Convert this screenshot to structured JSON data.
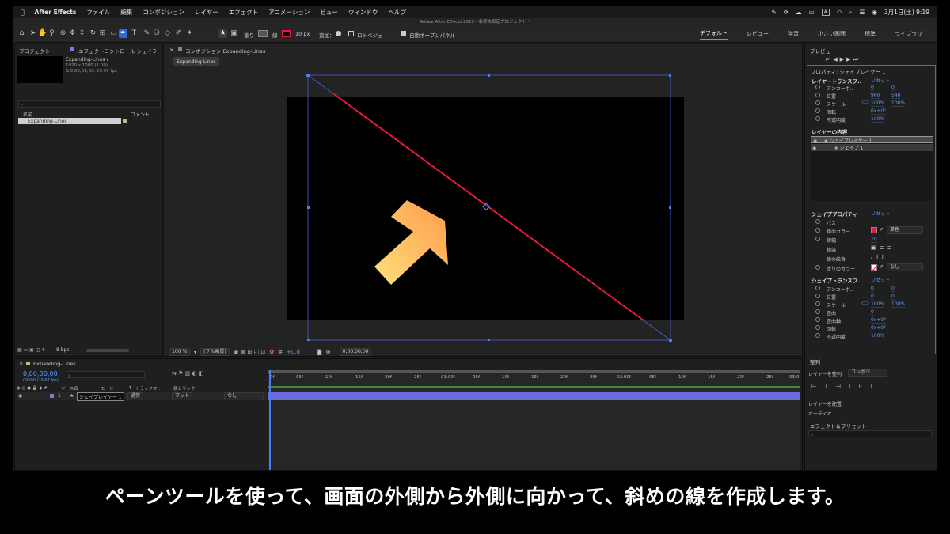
{
  "menubar": {
    "app": "After Effects",
    "items": [
      "ファイル",
      "編集",
      "コンポジション",
      "レイヤー",
      "エフェクト",
      "アニメーション",
      "ビュー",
      "ウィンドウ",
      "ヘルプ"
    ],
    "clock": "3月1日(土) 9:19",
    "input_mode": "A"
  },
  "window": {
    "title": "Adobe After Effects 2025 - 名称未設定プロジェクト *"
  },
  "toolbar": {
    "fill_label": "塗り",
    "stroke_label": "線",
    "stroke_width": "10 px",
    "add_label": "追加：",
    "rotobezier_label": "ロトベジェ",
    "auto_open_label": "自動オープンパネル",
    "workspaces": [
      "デフォルト",
      "レビュー",
      "学習",
      "小さい画面",
      "標準",
      "ライブラリ"
    ]
  },
  "project": {
    "tab_project": "プロジェクト",
    "tab_effect": "エフェクトコントロール シェイプ",
    "comp_name": "Expanding-Lines ▾",
    "comp_size": "1920 x 1080 (1.00)",
    "comp_duration": "Δ 0;00;03;00, 29.97 fps",
    "search_placeholder": "",
    "col_name": "名前",
    "col_comment": "コメント",
    "item_name": "Expanding-Lines",
    "bpc": "8 bpc"
  },
  "comp_panel": {
    "tab_label": "コンポジション Expanding-Lines",
    "flow_tab": "Expanding-Lines",
    "zoom": "100 %",
    "quality": "(フル画質)",
    "exposure": "+0.0",
    "timecode": "0;00;00;00"
  },
  "timeline": {
    "tab_label": "Expanding-Lines",
    "timecode": "0;00;00;00",
    "fps_sub": "00000 (29.97 fps)",
    "col_source": "ソース名",
    "col_mode": "モード",
    "col_t": "T",
    "col_track": "トラックマ..",
    "col_parent": "親とリンク",
    "layer_num": "1",
    "layer_name": "シェイプレイヤー 1",
    "layer_mode": "通常",
    "layer_matte": "マット",
    "layer_parent": "なし",
    "ruler": [
      "0f",
      "05f",
      "10f",
      "15f",
      "20f",
      "25f",
      "01:00f",
      "05f",
      "10f",
      "15f",
      "20f",
      "25f",
      "02:00f",
      "05f",
      "10f",
      "15f",
      "20f",
      "25f",
      "03:0"
    ]
  },
  "right_panel": {
    "preview_tab": "プレビュー",
    "props_tab": "プロパティ: シェイプレイヤー 1",
    "layer_transform": "レイヤートランスフ..",
    "reset": "リセット",
    "anchor": "アンカーポ..",
    "anchor_vals": [
      "0",
      "0"
    ],
    "position": "位置",
    "position_vals": [
      "960",
      "540"
    ],
    "scale": "スケール",
    "scale_vals": [
      "100%",
      "100%"
    ],
    "rotation": "回転",
    "rotation_val": "0x+0°",
    "opacity": "不透明度",
    "opacity_val": "100%",
    "layer_contents": "レイヤーの内容",
    "contents_item1": "★ シェイプレイヤー 1",
    "contents_item2": "★ シェイプ 1",
    "shape_props": "シェイププロパティ",
    "path": "パス",
    "stroke_color": "線のカラー",
    "stroke_type": "単色",
    "stroke_w": "線幅",
    "stroke_w_val": "10",
    "line_cap": "線端",
    "line_join": "線の結合",
    "fill_color": "塗りのカラー",
    "fill_type": "なし",
    "shape_transform": "シェイプトランスフ..",
    "anchor2_vals": [
      "0",
      "0"
    ],
    "position2_vals": [
      "0",
      "0"
    ],
    "scale2_vals": [
      "100%",
      "100%"
    ],
    "skew": "歪曲",
    "skew_val": "0",
    "skew_axis": "歪曲軸",
    "skew_axis_val": "0x+0°",
    "rotation2_val": "0x+0°",
    "opacity2_val": "100%",
    "align_tab": "整列",
    "align_to_label": "レイヤーを整列:",
    "align_to_val": "コンポジ..",
    "distribute_label": "レイヤーを配置:",
    "audio_label": "オーディオ",
    "effects_tab": "エフェクト＆プリセット"
  },
  "subtitle": "ペーンツールを使って、画面の外側から外側に向かって、斜めの線を作成します。",
  "colors": {
    "accent": "#5b9bff",
    "stroke_red": "#e8193d",
    "arrow_start": "#ffe07a",
    "arrow_end": "#ff9a4a"
  }
}
